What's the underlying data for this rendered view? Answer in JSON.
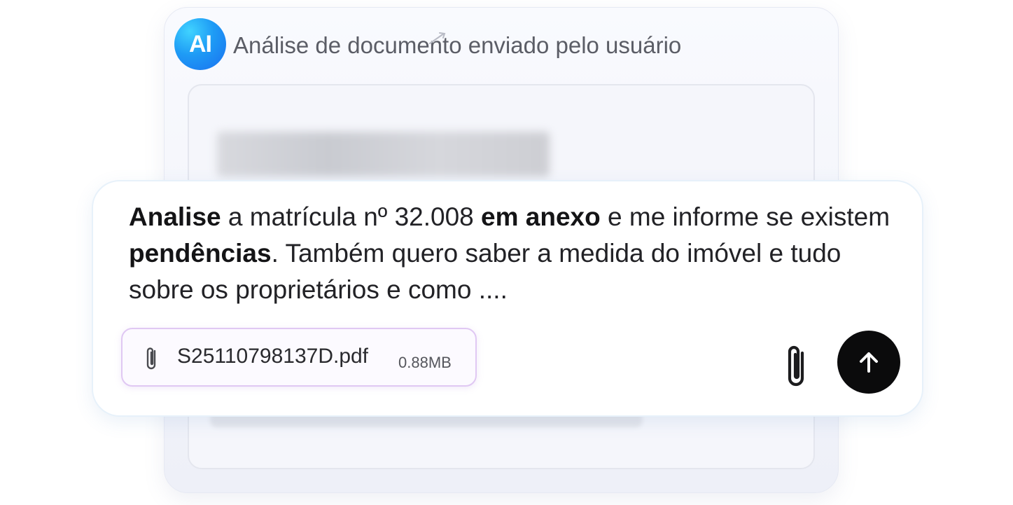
{
  "header": {
    "badge": "AI",
    "title": "Análise de documento enviado pelo usuário"
  },
  "prompt": {
    "segments": [
      {
        "text": "Analise",
        "bold": true
      },
      {
        "text": " a matrícula nº 32.008 ",
        "bold": false
      },
      {
        "text": "em anexo",
        "bold": true
      },
      {
        "text": " e me informe se existem ",
        "bold": false
      },
      {
        "text": "pendências",
        "bold": true
      },
      {
        "text": ". Também quero saber a medida do imóvel e tudo sobre os proprietários e como ....",
        "bold": false
      }
    ]
  },
  "attachment": {
    "filename": "S25110798137D.pdf",
    "size": "0.88MB",
    "icon": "paperclip-icon"
  },
  "actions": {
    "attach_icon": "paperclip-icon",
    "send_icon": "arrow-up-icon"
  },
  "colors": {
    "badge_gradient_start": "#40d3ff",
    "badge_gradient_end": "#1a6ff0",
    "send_button": "#0b0b0c",
    "chip_border": "#e0c8f3"
  }
}
